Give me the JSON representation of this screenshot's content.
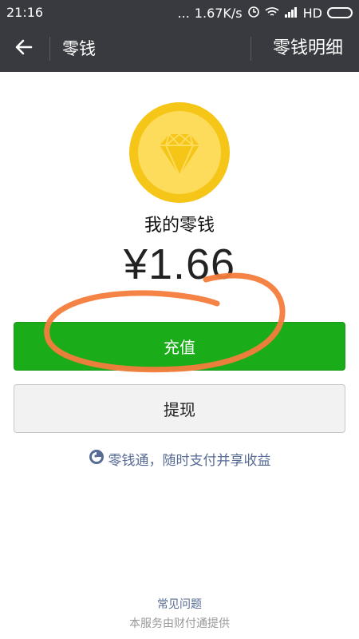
{
  "status_bar": {
    "time": "21:16",
    "dots": "...",
    "speed": "1.67K/s",
    "network": "HD"
  },
  "header": {
    "title": "零钱",
    "detail_link": "零钱明细"
  },
  "wallet": {
    "label": "我的零钱",
    "balance": "¥1.66"
  },
  "actions": {
    "recharge_label": "充值",
    "withdraw_label": "提现"
  },
  "promo": {
    "text": "零钱通，随时支付并享收益"
  },
  "footer": {
    "faq": "常见问题",
    "provider": "本服务由财付通提供"
  },
  "colors": {
    "title_bar": "#393a3f",
    "primary_green": "#1aad19",
    "link_blue": "#576b95",
    "coin_gold": "#f5c518",
    "annotation_orange": "#f47c3c"
  },
  "icons": [
    "back-arrow-icon",
    "diamond-icon",
    "lingqiantong-icon",
    "alarm-icon",
    "wifi-icon",
    "signal-icon",
    "battery-icon"
  ]
}
